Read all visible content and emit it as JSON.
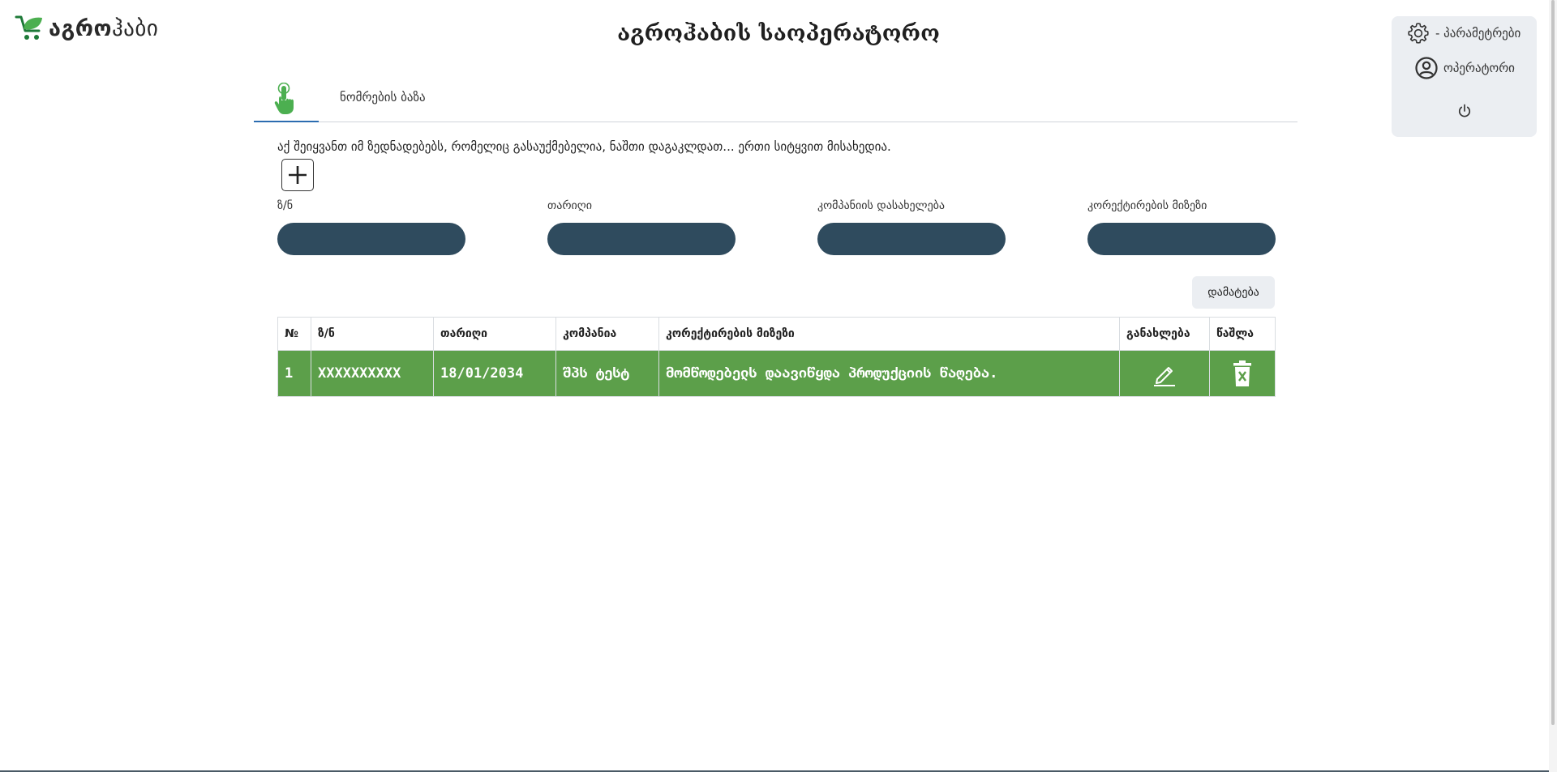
{
  "brand": {
    "logo_bold": "აგრო",
    "logo_light": "ჰაბი",
    "logo_icon": "cart-leaf-icon",
    "accent": "#4caf50"
  },
  "header": {
    "title": "აგროჰაბის საოპერატორო"
  },
  "user_panel": {
    "settings_label": "- პარამეტრები",
    "settings_icon": "gear-icon",
    "operator_label": "ოპერატორი",
    "operator_icon": "user-circle-icon",
    "logout_icon": "power-icon"
  },
  "tabs": {
    "active_icon": "hand-pointer-icon",
    "numbers_db_label": "ნომრების ბაზა"
  },
  "description": "აქ შეიყვანთ იმ ზედნადებებს, რომელიც გასაუქმებელია, ნაშთი დაგაკლდათ... ერთი სიტყვით მისახედია.",
  "form": {
    "fields": [
      {
        "label": "ზ/ნ",
        "value": ""
      },
      {
        "label": "თარიღი",
        "value": ""
      },
      {
        "label": "კომპანიის დასახელება",
        "value": ""
      },
      {
        "label": "კორექტირების მიზეზი",
        "value": ""
      }
    ],
    "add_button": "დამატება",
    "input_color": "#2f4b5e"
  },
  "table": {
    "columns": [
      "№",
      "ზ/ნ",
      "თარიღი",
      "კომპანია",
      "კორექტირების მიზეზი",
      "განახლება",
      "წაშლა"
    ],
    "rows": [
      {
        "num": "1",
        "invoice": "XXXXXXXXXX",
        "date": "18/01/2034",
        "company": "შპს ტესტ",
        "reason": "მომწოდებელს დაავიწყდა პროდუქციის წაღება.",
        "edit_icon": "pencil-icon",
        "delete_icon": "trash-icon"
      }
    ],
    "row_color": "#5c9f4a"
  }
}
